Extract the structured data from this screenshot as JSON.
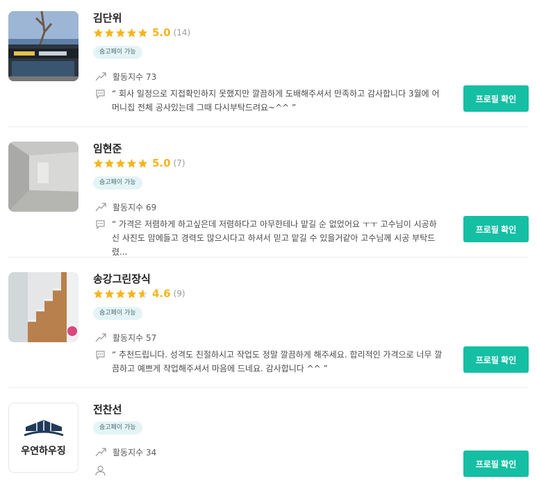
{
  "common": {
    "badge_label": "숨고페이 가능",
    "button_label": "프로필 확인"
  },
  "colors": {
    "accent": "#15bfa4",
    "star": "#f5b51b",
    "badge_bg": "#e4f4f6"
  },
  "experts": [
    {
      "name": "김단위",
      "rating": "5.0",
      "stars": 5,
      "review_count": "(14)",
      "activity": "활동지수 73",
      "review": "“ 회사 일정으로 지접확인하지 못했지만 깔끔하게 도배해주셔서 만족하고 감사합니다 3월에 어머니집 전체 공사있는데 그때 다시부탁드려요~^^ ”"
    },
    {
      "name": "임현준",
      "rating": "5.0",
      "stars": 5,
      "review_count": "(7)",
      "activity": "활동지수 69",
      "review": "“ 가격은 저렴하게 하고싶은데 저렴하다고 아무한테나 맡길 순 없었어요 ㅜㅜ 고수님이 시공하신 사진도 맘에들고 경력도 많으시다고 하셔서 믿고 맡길 수 있을거같아 고수님께 시공 부탁드렸..."
    },
    {
      "name": "송강그린장식",
      "rating": "4.6",
      "stars": 4.6,
      "review_count": "(9)",
      "activity": "활동지수 57",
      "review": "“ 추천드립니다. 성격도 친절하시고 작업도 정말 깔끔하게 해주세요. 합리적인 가격으로 너무 깔끔하고 예쁘게 작업해주셔서 마음에 드네요. 감사합니다 ^^ ”"
    },
    {
      "name": "전찬선",
      "activity": "활동지수 34",
      "logo_text": "우연하우징"
    }
  ]
}
